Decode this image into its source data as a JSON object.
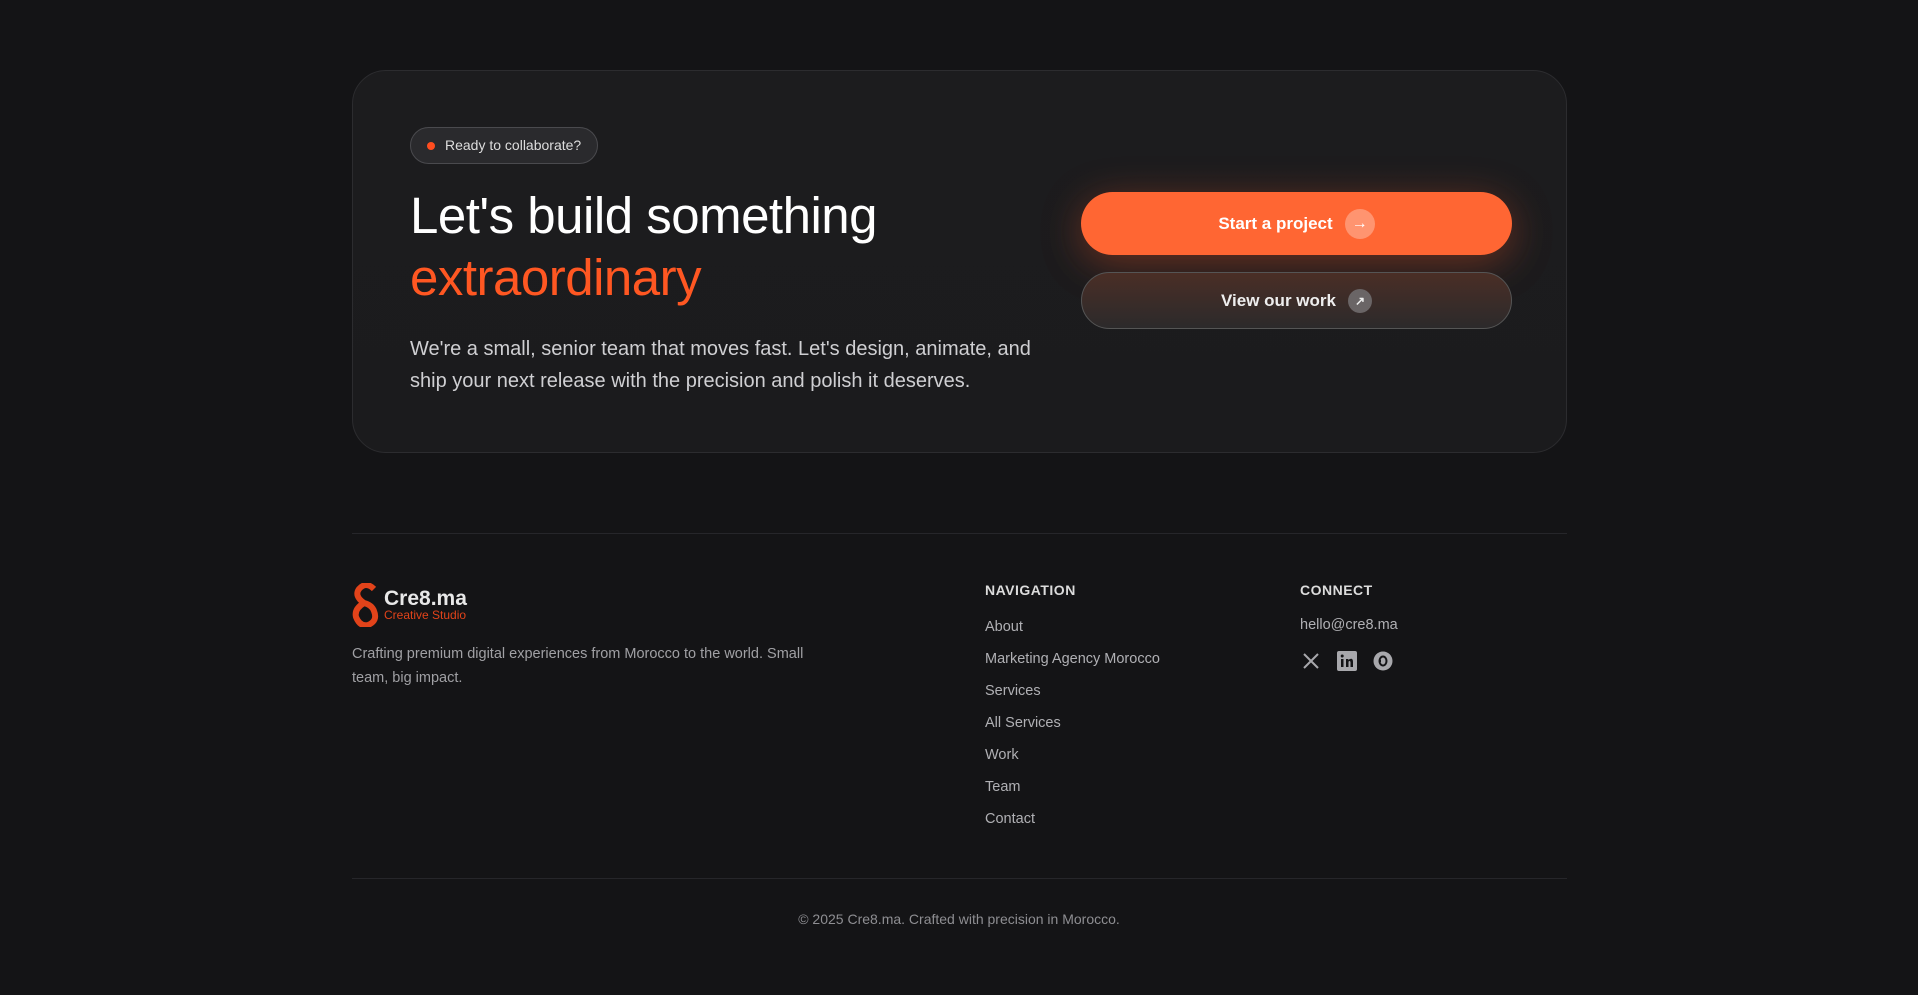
{
  "cta": {
    "badge": "Ready to collaborate?",
    "heading_line1": "Let's build something",
    "heading_line2": "extraordinary",
    "paragraph": "We're a small, senior team that moves fast. Let's design, animate, and ship your next release with the precision and polish it deserves.",
    "primary_button": "Start a project",
    "secondary_button": "View our work",
    "accent_color": "#ff6633"
  },
  "footer": {
    "logo_name": "Cre8.ma",
    "logo_tagline": "Creative Studio",
    "description": "Crafting premium digital experiences from Morocco to the world. Small team, big impact.",
    "navigation_heading": "NAVIGATION",
    "navigation": [
      "About",
      "Marketing Agency Morocco",
      "Services",
      "All Services",
      "Work",
      "Team",
      "Contact"
    ],
    "connect_heading": "CONNECT",
    "email": "hello@cre8.ma",
    "social_icons": [
      "x-icon",
      "linkedin-icon",
      "behance-icon"
    ],
    "copyright": "© 2025 Cre8.ma. Crafted with precision in Morocco."
  }
}
